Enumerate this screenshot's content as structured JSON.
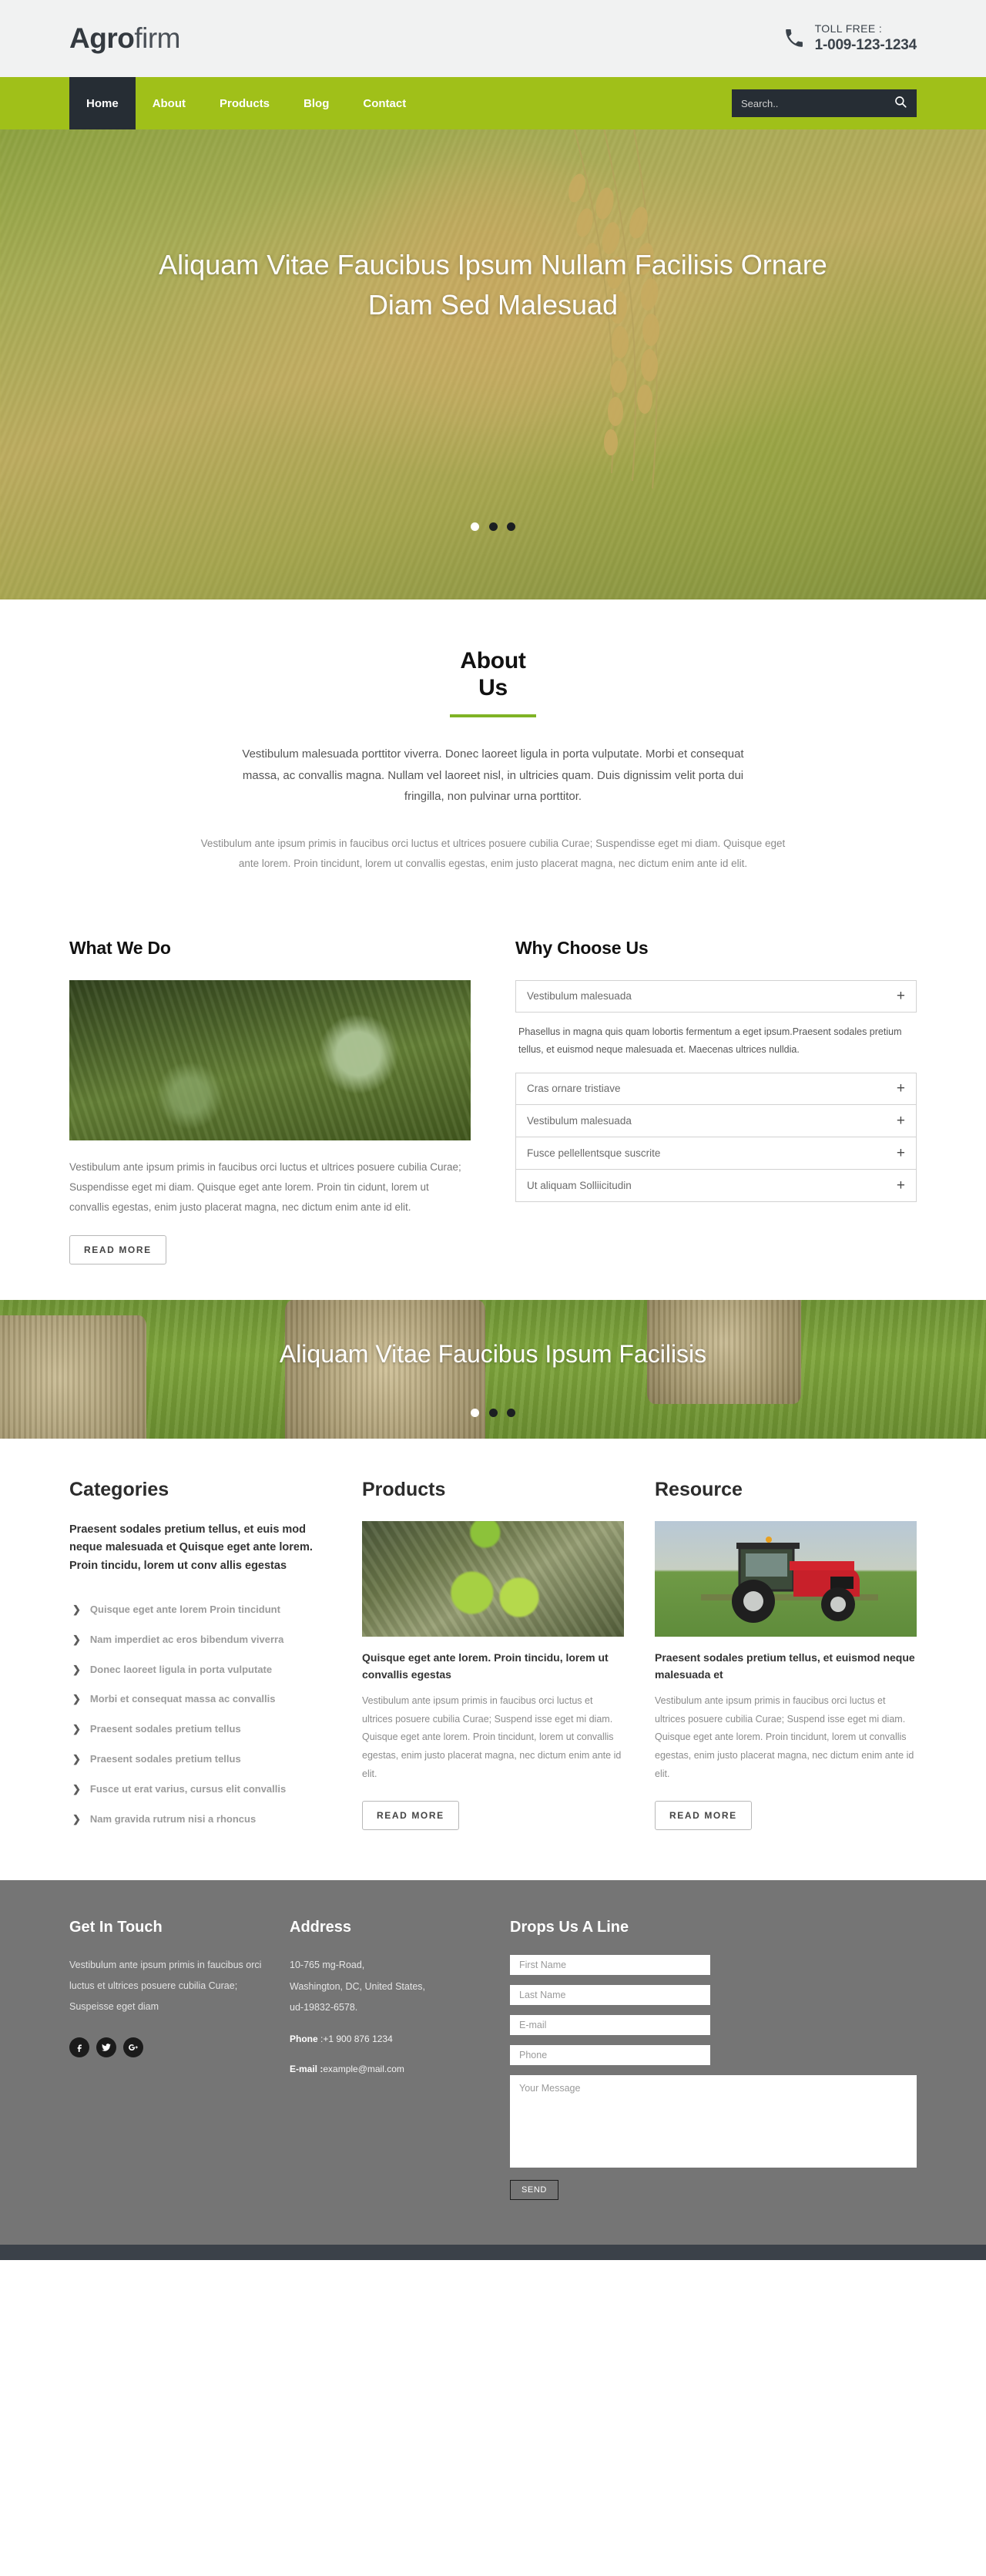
{
  "header": {
    "logo_bold": "Agro",
    "logo_light": "firm",
    "toll_label": "TOLL FREE :",
    "toll_number": "1-009-123-1234",
    "phone_icon": "phone-icon"
  },
  "nav": {
    "items": [
      {
        "label": "Home",
        "active": true
      },
      {
        "label": "About",
        "active": false
      },
      {
        "label": "Products",
        "active": false
      },
      {
        "label": "Blog",
        "active": false
      },
      {
        "label": "Contact",
        "active": false
      }
    ],
    "search_placeholder": "Search..",
    "search_value": "",
    "search_icon": "search-icon",
    "accent_color": "#a0c019",
    "dark_color": "#262d34"
  },
  "hero": {
    "title": "Aliquam Vitae Faucibus Ipsum Nullam Facilisis Ornare Diam Sed Malesuad",
    "dots": [
      {
        "active": true
      },
      {
        "active": false
      },
      {
        "active": false
      }
    ]
  },
  "about": {
    "title_line1": "About",
    "title_line2": "Us",
    "rule_color": "#7fb325",
    "lead": "Vestibulum malesuada porttitor viverra. Donec laoreet ligula in porta vulputate. Morbi et consequat massa, ac convallis magna. Nullam vel laoreet nisl, in ultricies quam. Duis dignissim velit porta dui fringilla, non pulvinar urna porttitor.",
    "sub": "Vestibulum ante ipsum primis in faucibus orci luctus et ultrices posuere cubilia Curae; Suspendisse eget mi diam. Quisque eget ante lorem. Proin tincidunt, lorem ut convallis egestas, enim justo placerat magna, nec dictum enim ante id elit."
  },
  "what_we_do": {
    "title": "What We Do",
    "image": "artichoke-field-photo",
    "body": "Vestibulum ante ipsum primis in faucibus orci luctus et ultrices posuere cubilia Curae; Suspendisse eget mi diam. Quisque eget ante lorem. Proin tin cidunt, lorem ut convallis egestas, enim justo placerat magna, nec dictum enim ante id elit.",
    "button": "READ MORE"
  },
  "why_choose_us": {
    "title": "Why Choose Us",
    "open_item": "Vestibulum malesuada",
    "open_panel": "Phasellus in magna quis quam lobortis fermentum a eget ipsum.Praesent sodales pretium tellus, et euismod neque malesuada et. Maecenas ultrices nulldia.",
    "items": [
      {
        "label": "Cras ornare tristiave",
        "icon": "plus-icon"
      },
      {
        "label": "Vestibulum malesuada",
        "icon": "plus-icon"
      },
      {
        "label": "Fusce pellellentsque suscrite",
        "icon": "plus-icon"
      },
      {
        "label": "Ut aliquam Solliicitudin",
        "icon": "plus-icon"
      }
    ],
    "plus_icon": "plus-icon"
  },
  "mid_banner": {
    "title": "Aliquam Vitae Faucibus Ipsum Facilisis",
    "dots": [
      {
        "active": true
      },
      {
        "active": false
      },
      {
        "active": false
      }
    ]
  },
  "categories": {
    "title": "Categories",
    "strong": "Praesent sodales pretium tellus, et euis mod neque malesuada et Quisque eget ante lorem. Proin tincidu, lorem ut conv allis egestas",
    "items": [
      "Quisque eget ante lorem Proin tincidunt",
      "Nam imperdiet ac eros bibendum viverra",
      "Donec laoreet ligula in porta vulputate",
      "Morbi et consequat massa ac convallis",
      "Praesent sodales pretium tellus",
      "Praesent sodales pretium tellus",
      "Fusce ut erat varius, cursus elit convallis",
      "Nam gravida rutrum nisi a rhoncus"
    ],
    "chevron_icon": "chevron-right-icon"
  },
  "products": {
    "title": "Products",
    "image": "olive-branch-photo",
    "heading": "Quisque eget ante lorem. Proin tincidu, lorem ut convallis egestas",
    "body": "Vestibulum ante ipsum primis in faucibus orci luctus et ultrices posuere cubilia Curae; Suspend isse eget mi diam. Quisque eget ante lorem. Proin tincidunt, lorem ut convallis egestas, enim justo placerat magna, nec dictum enim ante id elit.",
    "button": "READ MORE"
  },
  "resource": {
    "title": "Resource",
    "image": "red-tractor-photo",
    "heading": "Praesent sodales pretium tellus, et euismod neque malesuada et",
    "body": "Vestibulum ante ipsum primis in faucibus orci luctus et ultrices posuere cubilia Curae; Suspend isse eget mi diam. Quisque eget ante lorem. Proin tincidunt, lorem ut convallis egestas, enim justo placerat magna, nec dictum enim ante id elit.",
    "button": "READ MORE"
  },
  "footer": {
    "get_in_touch": {
      "title": "Get In Touch",
      "body": "Vestibulum ante ipsum primis in faucibus orci luctus et ultrices posuere cubilia Curae; Suspeisse eget diam",
      "socials": [
        {
          "name": "facebook-icon"
        },
        {
          "name": "twitter-icon"
        },
        {
          "name": "google-plus-icon"
        }
      ]
    },
    "address": {
      "title": "Address",
      "line1": "10-765 mg-Road,",
      "line2": "Washington, DC, United States,",
      "line3": "ud-19832-6578.",
      "phone_label": "Phone",
      "phone_value": " :+1 900 876 1234",
      "email_label": "E-mail :",
      "email_value": "example@mail.com"
    },
    "form": {
      "title": "Drops Us A Line",
      "first_name_placeholder": "First Name",
      "first_name_value": "",
      "last_name_placeholder": "Last Name",
      "last_name_value": "",
      "email_placeholder": "E-mail",
      "email_value": "",
      "phone_placeholder": "Phone",
      "phone_value": "",
      "message_placeholder": "Your Message",
      "message_value": "",
      "send_label": "SEND"
    }
  }
}
